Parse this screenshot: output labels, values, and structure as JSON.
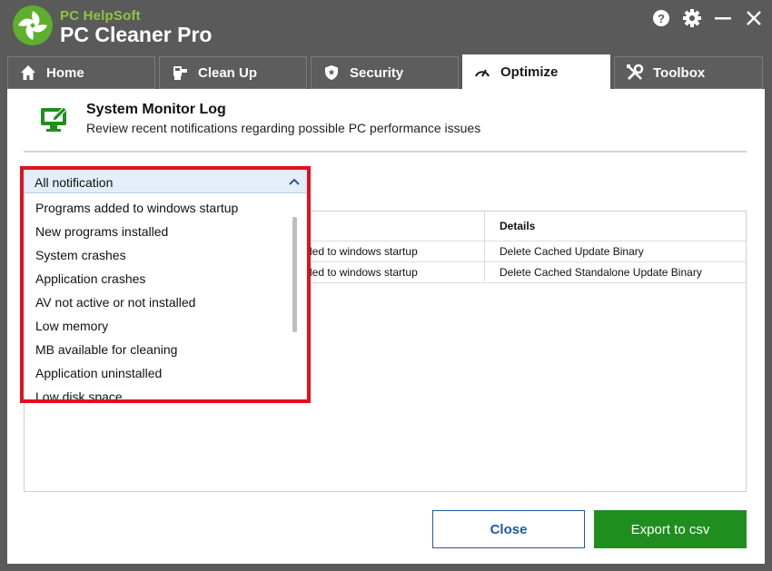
{
  "app": {
    "brand_small": "PC HelpSoft",
    "brand_name": "PC Cleaner Pro"
  },
  "window_controls": {
    "help_icon": "help-icon",
    "settings_icon": "gear-icon",
    "minimize_icon": "minimize-icon",
    "close_icon": "close-icon"
  },
  "tabs": [
    {
      "label": "Home",
      "icon": "home-icon",
      "active": false
    },
    {
      "label": "Clean Up",
      "icon": "broom-icon",
      "active": false
    },
    {
      "label": "Security",
      "icon": "shield-icon",
      "active": false
    },
    {
      "label": "Optimize",
      "icon": "speedometer-icon",
      "active": true
    },
    {
      "label": "Toolbox",
      "icon": "tools-icon",
      "active": false
    }
  ],
  "header": {
    "title": "System Monitor Log",
    "subtitle": "Review recent notifications regarding possible PC performance issues",
    "icon": "monitor-edit-icon"
  },
  "table": {
    "columns": [
      "",
      "Details"
    ],
    "rows": [
      {
        "notification": "ded to windows startup",
        "details": "Delete Cached Update Binary"
      },
      {
        "notification": "ded to windows startup",
        "details": "Delete Cached Standalone Update Binary"
      }
    ]
  },
  "filter_dropdown": {
    "selected": "All notification",
    "options": [
      "Programs added to windows startup",
      "New programs installed",
      "System crashes",
      "Application crashes",
      "AV not active or not installed",
      "Low memory",
      "MB available for cleaning",
      "Application uninstalled",
      "Low disk space"
    ]
  },
  "buttons": {
    "close": "Close",
    "export": "Export to csv"
  },
  "colors": {
    "accent_green": "#1f8e1f",
    "brand_green": "#8cc63f",
    "highlight_red": "#e3101b",
    "close_blue": "#1c5aa6",
    "chrome_gray": "#5a5a5a"
  }
}
